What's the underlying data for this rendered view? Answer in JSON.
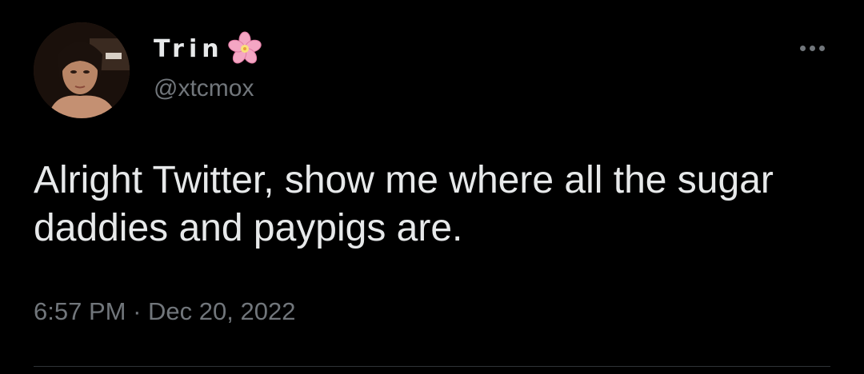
{
  "author": {
    "display_name": "Trin",
    "name_emoji": "cherry-blossom-icon",
    "handle": "@xtcmox",
    "avatar": "profile-photo"
  },
  "tweet": {
    "text": "Alright Twitter, show me where all the sugar daddies and paypigs are.",
    "time": "6:57 PM",
    "separator": "·",
    "date": "Dec 20, 2022"
  },
  "actions": {
    "more_icon": "more-horizontal-icon"
  },
  "colors": {
    "background": "#000000",
    "primary_text": "#e7e9ea",
    "secondary_text": "#71767b",
    "divider": "#2f3336",
    "blossom": "#f4a6c3"
  }
}
